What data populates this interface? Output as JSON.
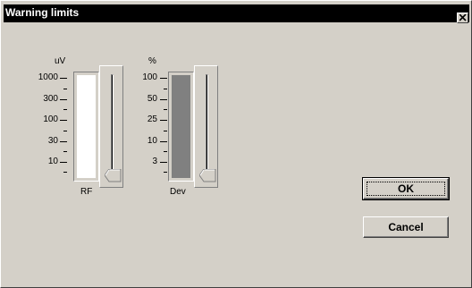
{
  "window": {
    "title": "Warning limits"
  },
  "rf": {
    "unit": "uV",
    "caption": "RF",
    "ticks": [
      "1000",
      "300",
      "100",
      "30",
      "10"
    ],
    "fill_color": "#ffffff",
    "slider_level": 0
  },
  "dev": {
    "unit": "%",
    "caption": "Dev",
    "ticks": [
      "100",
      "50",
      "25",
      "10",
      "3"
    ],
    "fill_color": "#808080",
    "slider_level": 0
  },
  "buttons": {
    "ok": "OK",
    "cancel": "Cancel"
  },
  "icons": {
    "close": "close-icon"
  }
}
